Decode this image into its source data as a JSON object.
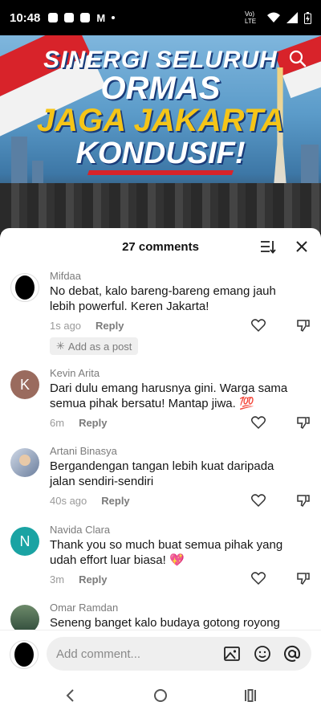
{
  "status_bar": {
    "time": "10:48",
    "network_label": "Vo) LTE"
  },
  "video": {
    "title_line1": "SINERGI SELURUH",
    "title_line2": "ORMAS",
    "title_line3": "JAGA JAKARTA",
    "title_line4": "KONDUSIF!"
  },
  "sheet": {
    "title": "27 comments"
  },
  "comments": [
    {
      "user": "Mifdaa",
      "text": "No debat, kalo bareng-bareng emang jauh lebih powerful. Keren Jakarta!",
      "time": "1s ago",
      "reply": "Reply",
      "chip": "Add as a post",
      "avatar_letter": ""
    },
    {
      "user": "Kevin Arita",
      "text": "Dari dulu emang harusnya gini. Warga sama semua pihak bersatu! Mantap jiwa. 💯",
      "time": "6m",
      "reply": "Reply",
      "avatar_letter": "K"
    },
    {
      "user": "Artani Binasya",
      "text": "Bergandengan tangan lebih kuat daripada jalan sendiri-sendiri",
      "time": "40s ago",
      "reply": "Reply",
      "avatar_letter": ""
    },
    {
      "user": "Navida Clara",
      "text": "Thank you so much buat semua pihak yang udah effort luar biasa! 💖",
      "time": "3m",
      "reply": "Reply",
      "avatar_letter": "N"
    },
    {
      "user": "Omar Ramdan",
      "text": "Seneng banget kalo budaya gotong royong",
      "avatar_letter": ""
    }
  ],
  "composer": {
    "placeholder": "Add comment..."
  },
  "colors": {
    "avatar_k": "#9a6b5e",
    "avatar_n": "#1aa3a3",
    "accent_red": "#d8232a",
    "title_yellow": "#f5c518"
  }
}
